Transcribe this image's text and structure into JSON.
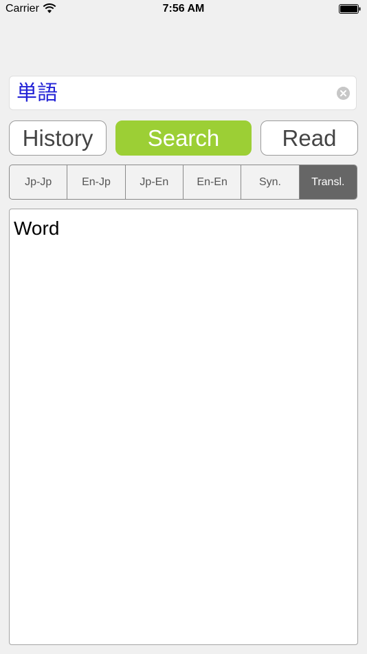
{
  "status_bar": {
    "carrier": "Carrier",
    "time": "7:56 AM"
  },
  "search": {
    "value": "単語"
  },
  "actions": {
    "history": "History",
    "search": "Search",
    "read": "Read"
  },
  "segments": [
    {
      "label": "Jp-Jp",
      "selected": false
    },
    {
      "label": "En-Jp",
      "selected": false
    },
    {
      "label": "Jp-En",
      "selected": false
    },
    {
      "label": "En-En",
      "selected": false
    },
    {
      "label": "Syn.",
      "selected": false
    },
    {
      "label": "Transl.",
      "selected": true
    }
  ],
  "content": {
    "text": "Word"
  },
  "colors": {
    "accent_green": "#9ccf35",
    "selected_segment": "#666666",
    "search_text": "#2323d6"
  }
}
